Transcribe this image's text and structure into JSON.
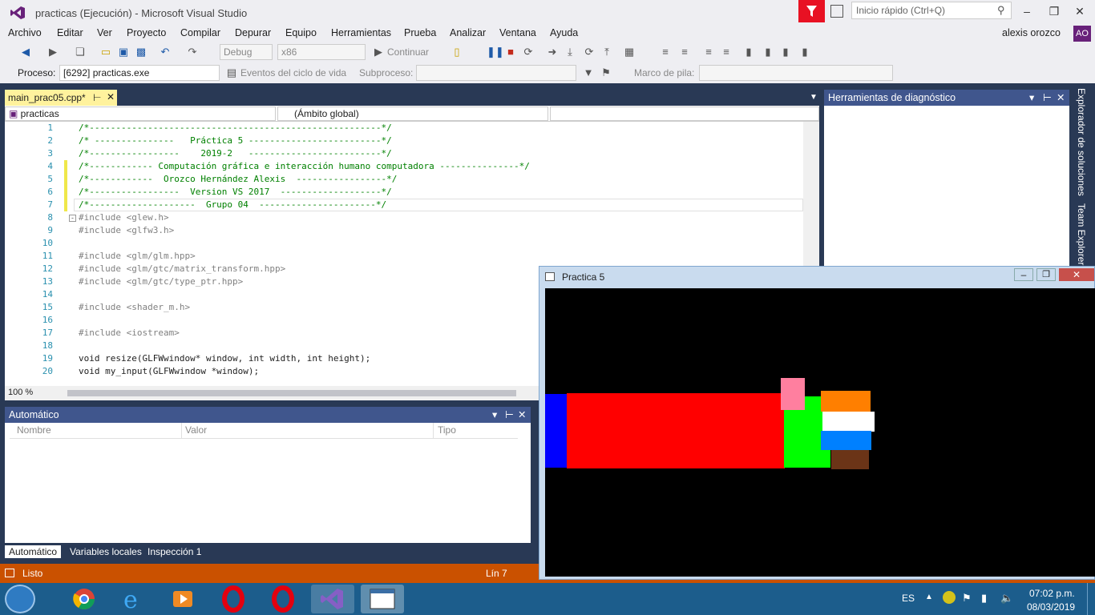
{
  "window": {
    "title": "practicas (Ejecución) - Microsoft Visual Studio",
    "quick_launch_placeholder": "Inicio rápido (Ctrl+Q)"
  },
  "menu": [
    "Archivo",
    "Editar",
    "Ver",
    "Proyecto",
    "Compilar",
    "Depurar",
    "Equipo",
    "Herramientas",
    "Prueba",
    "Analizar",
    "Ventana",
    "Ayuda"
  ],
  "user": {
    "name": "alexis orozco",
    "initials": "AO"
  },
  "toolbar": {
    "config": "Debug",
    "platform": "x86",
    "continue": "Continuar"
  },
  "debug_bar": {
    "process_label": "Proceso:",
    "process_value": "[6292] practicas.exe",
    "lifecycle": "Eventos del ciclo de vida",
    "thread_label": "Subproceso:",
    "stack_label": "Marco de pila:"
  },
  "editor": {
    "tab": "main_prac05.cpp*",
    "project": "practicas",
    "scope": "(Ámbito global)",
    "zoom": "100 %",
    "lines": [
      {
        "n": "1",
        "t": "/*-------------------------------------------------------*/"
      },
      {
        "n": "2",
        "t": "/* ---------------   Práctica 5 -------------------------*/"
      },
      {
        "n": "3",
        "t": "/*-----------------    2019-2   -------------------------*/"
      },
      {
        "n": "4",
        "t": "/*------------ Computación gráfica e interacción humano computadora ---------------*/"
      },
      {
        "n": "5",
        "t": "/*------------  Orozco Hernández Alexis  -----------------*/"
      },
      {
        "n": "6",
        "t": "/*-----------------  Version VS 2017  -------------------*/"
      },
      {
        "n": "7",
        "t": "/*--------------------  Grupo 04  ----------------------*/"
      },
      {
        "n": "8",
        "t": "#include <glew.h>"
      },
      {
        "n": "9",
        "t": "#include <glfw3.h>"
      },
      {
        "n": "10",
        "t": ""
      },
      {
        "n": "11",
        "t": "#include <glm/glm.hpp>"
      },
      {
        "n": "12",
        "t": "#include <glm/gtc/matrix_transform.hpp>"
      },
      {
        "n": "13",
        "t": "#include <glm/gtc/type_ptr.hpp>"
      },
      {
        "n": "14",
        "t": ""
      },
      {
        "n": "15",
        "t": "#include <shader_m.h>"
      },
      {
        "n": "16",
        "t": ""
      },
      {
        "n": "17",
        "t": "#include <iostream>"
      },
      {
        "n": "18",
        "t": ""
      },
      {
        "n": "19",
        "t": "void resize(GLFWwindow* window, int width, int height);"
      },
      {
        "n": "20",
        "t": "void my_input(GLFWwindow *window);"
      }
    ]
  },
  "diagnostics": {
    "title": "Herramientas de diagnóstico"
  },
  "side_tabs": [
    "Explorador de soluciones",
    "Team Explorer"
  ],
  "autos": {
    "title": "Automático",
    "columns": [
      "Nombre",
      "Valor",
      "Tipo"
    ],
    "tabs": [
      "Automático",
      "Variables locales",
      "Inspección 1"
    ]
  },
  "status": {
    "text": "Listo",
    "line": "Lín 7"
  },
  "gl_window": {
    "title": "Practica 5"
  },
  "tray": {
    "lang": "ES",
    "time": "07:02 p.m.",
    "date": "08/03/2019"
  },
  "colors": {
    "accent": "#68217a",
    "status": "#ca5100",
    "panel_header": "#40568d"
  }
}
